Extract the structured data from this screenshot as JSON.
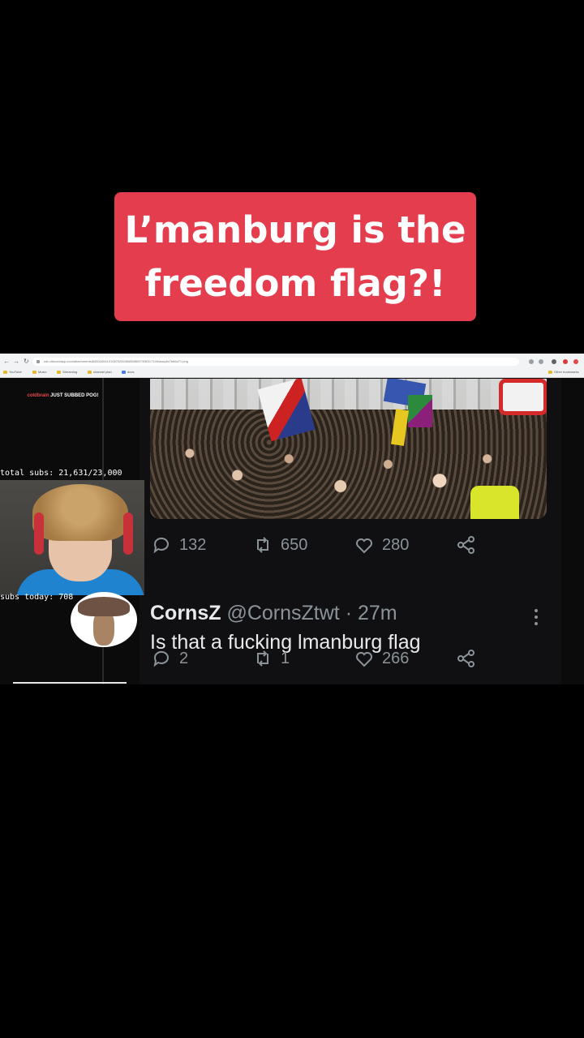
{
  "caption": {
    "text": "L’manburg is the freedom flag?!",
    "background_color": "#e33d4e"
  },
  "browser": {
    "url": "cdn.discordapp.com/attachments/845044541010870282/868548657398317146/awqdlx7b66d71.png",
    "bookmarks": [
      "YouTube",
      "Music",
      "Streaming",
      "channel plan",
      "docs",
      "Other bookmarks"
    ]
  },
  "stream_overlay": {
    "sub_alert_brand": "coldbrain",
    "sub_alert_message": "JUST SUBBED POG!",
    "total_subs": "total subs: 21,631/23,000",
    "subs_today": "subs today: 708"
  },
  "tweets": [
    {
      "replies": "132",
      "retweets": "650",
      "likes": "280"
    },
    {
      "name": "CornsZ",
      "handle": "@CornsZtwt",
      "time": "· 27m",
      "text": "Is that a fucking lmanburg flag",
      "replies": "2",
      "retweets": "1",
      "likes": "266"
    }
  ],
  "icons": {
    "reply": "reply-icon",
    "retweet": "retweet-icon",
    "like": "heart-icon",
    "share": "share-icon",
    "more": "more-vertical-icon"
  }
}
